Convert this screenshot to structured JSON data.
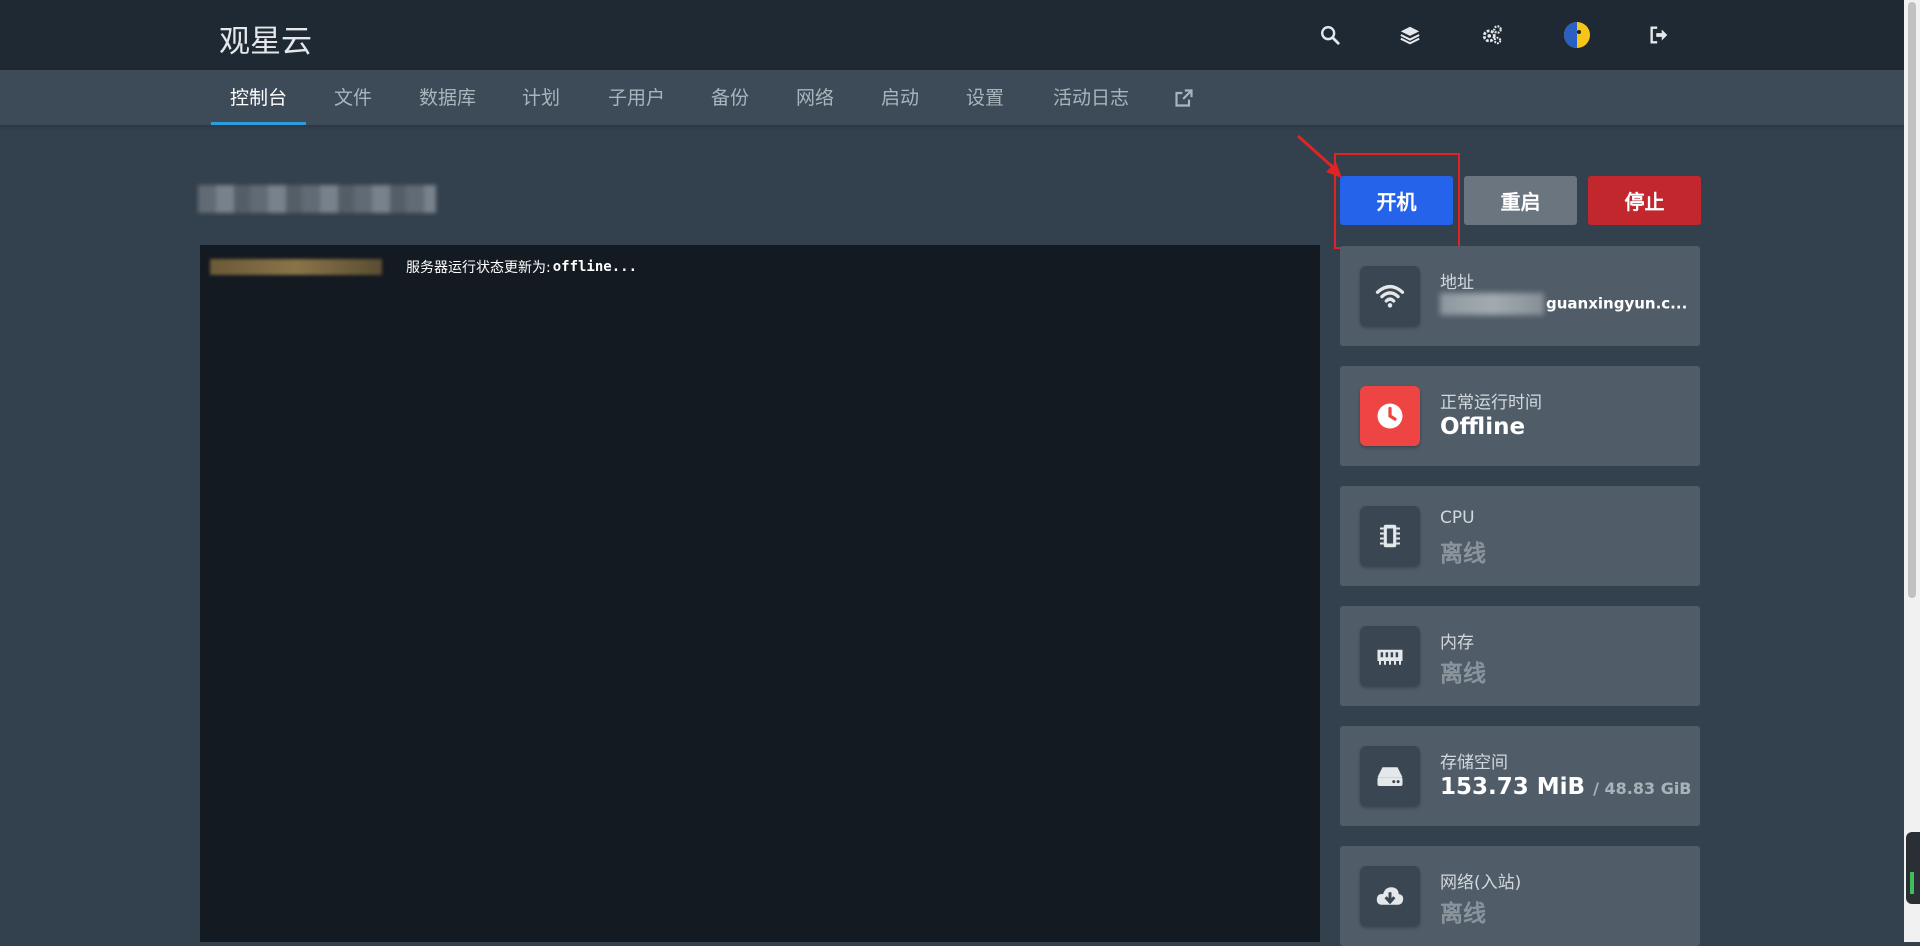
{
  "header": {
    "brand": "观星云",
    "icons": [
      "search-icon",
      "layers-icon",
      "gears-icon",
      "avatar",
      "logout-icon"
    ]
  },
  "nav": {
    "tabs": [
      "控制台",
      "文件",
      "数据库",
      "计划",
      "子用户",
      "备份",
      "网络",
      "启动",
      "设置",
      "活动日志"
    ],
    "active": "控制台",
    "external_icon": "external-link-icon"
  },
  "console": {
    "message": "服务器运行状态更新为:",
    "status": "offline..."
  },
  "power": {
    "start": "开机",
    "restart": "重启",
    "stop": "停止"
  },
  "stats": {
    "address": {
      "label": "地址",
      "value": "guanxingyun.c...",
      "icon": "wifi-icon"
    },
    "uptime": {
      "label": "正常运行时间",
      "value": "Offline",
      "icon": "clock-icon",
      "accent": "#ef4444"
    },
    "cpu": {
      "label": "CPU",
      "value": "离线",
      "icon": "cpu-icon"
    },
    "memory": {
      "label": "内存",
      "value": "离线",
      "icon": "memory-icon"
    },
    "storage": {
      "label": "存储空间",
      "value": "153.73 MiB",
      "limit": "/ 48.83 GiB",
      "icon": "hdd-icon"
    },
    "network_in": {
      "label": "网络(入站)",
      "value": "离线",
      "icon": "cloud-download-icon"
    }
  },
  "colors": {
    "start": "#2563eb",
    "restart": "#6b7580",
    "stop": "#c1272d",
    "highlight": "#e02424"
  }
}
